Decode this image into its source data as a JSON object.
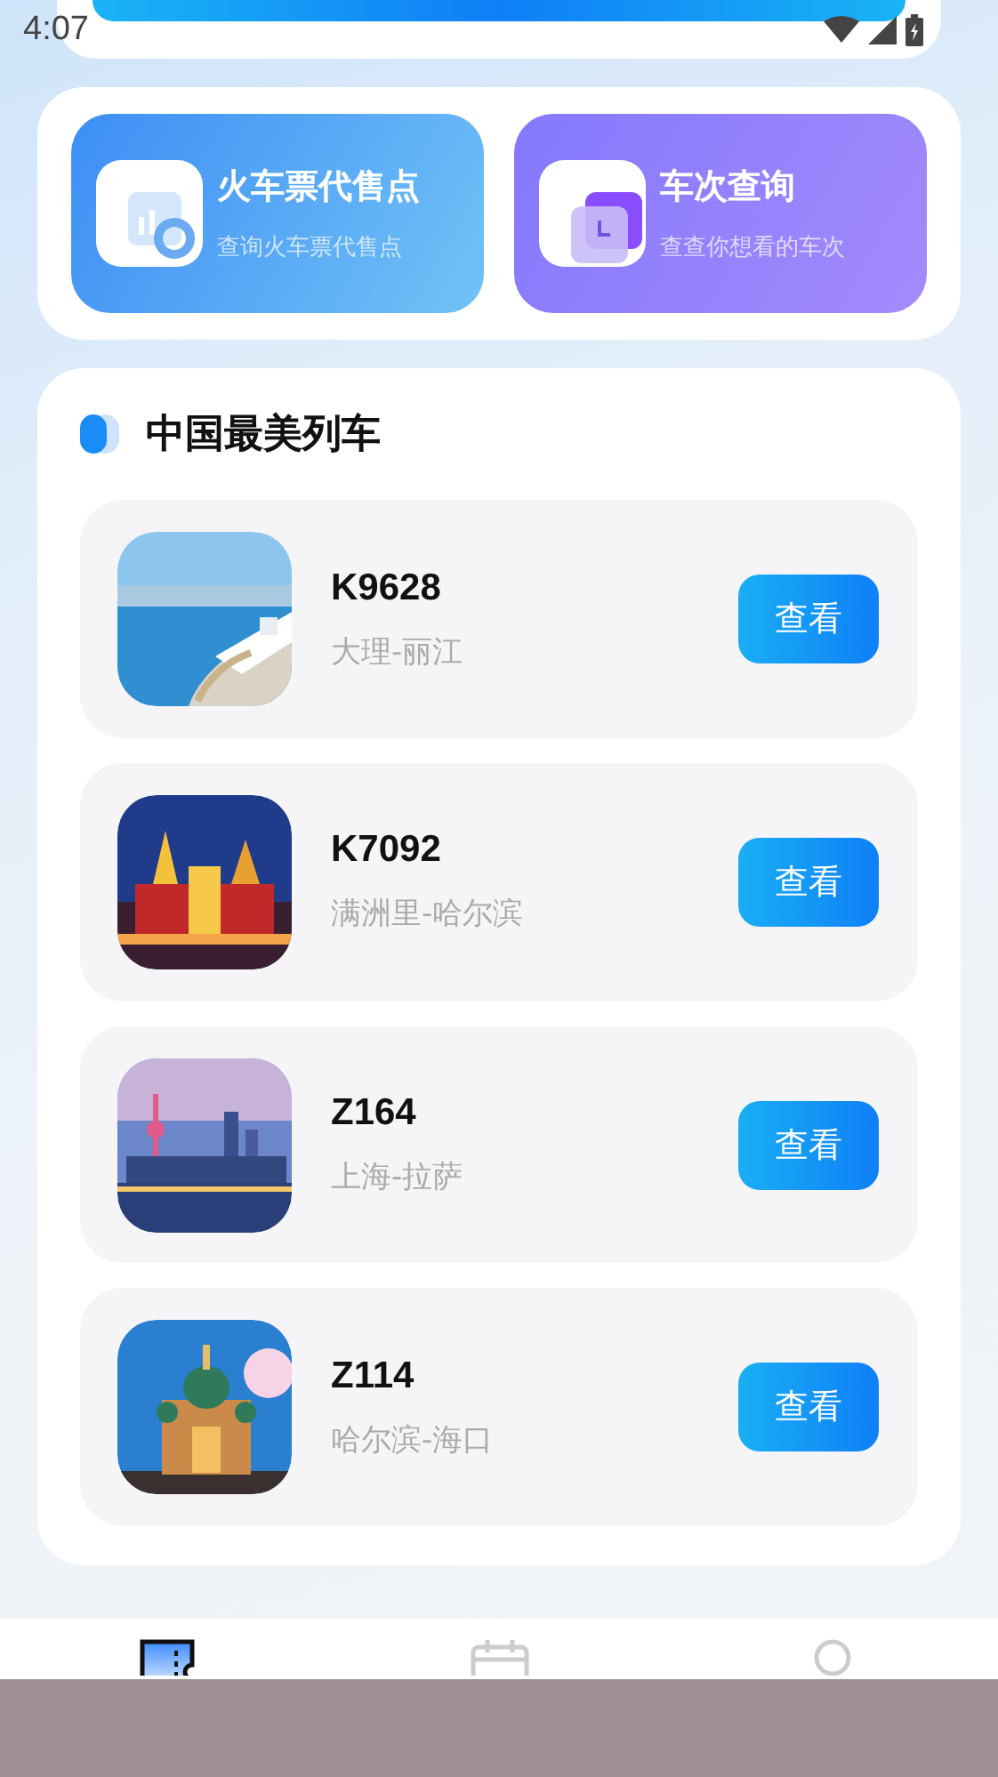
{
  "status_bar": {
    "time": "4:07"
  },
  "shortcuts": [
    {
      "kind": "outlets",
      "title": "火车票代售点",
      "subtitle": "查询火车票代售点"
    },
    {
      "kind": "lookup",
      "title": "车次查询",
      "subtitle": "查查你想看的车次"
    }
  ],
  "section": {
    "title": "中国最美列车"
  },
  "trains": [
    {
      "number": "K9628",
      "route": "大理-丽江",
      "button": "查看"
    },
    {
      "number": "K7092",
      "route": "满洲里-哈尔滨",
      "button": "查看"
    },
    {
      "number": "Z164",
      "route": "上海-拉萨",
      "button": "查看"
    },
    {
      "number": "Z114",
      "route": "哈尔滨-海口",
      "button": "查看"
    }
  ],
  "tabs": [
    {
      "kind": "ticket",
      "selected": true
    },
    {
      "kind": "calendar",
      "selected": false
    },
    {
      "kind": "pin",
      "selected": false
    }
  ]
}
